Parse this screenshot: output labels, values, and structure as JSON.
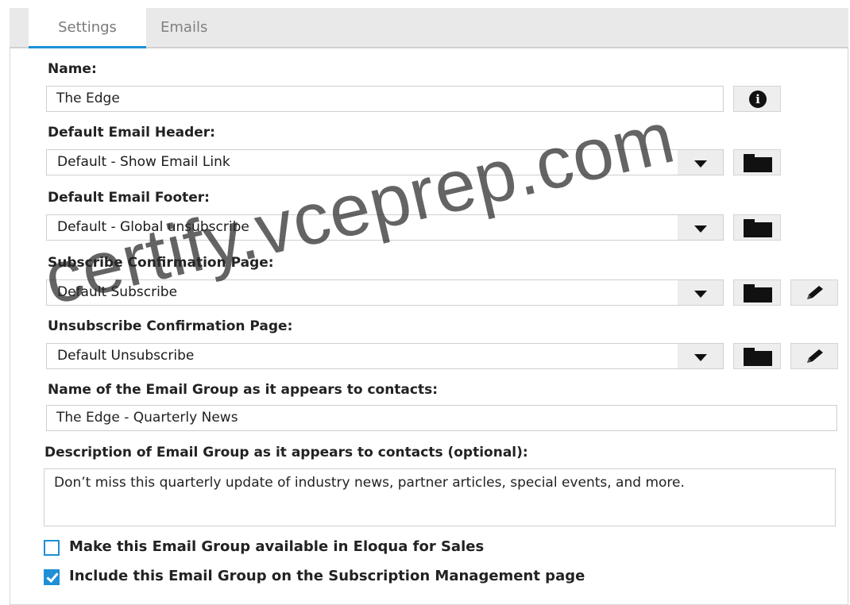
{
  "tabs": [
    {
      "label": "Settings",
      "active": true
    },
    {
      "label": "Emails",
      "active": false
    }
  ],
  "name": {
    "label": "Name:",
    "value": "The Edge",
    "info_icon": "info-icon"
  },
  "header": {
    "label": "Default Email Header:",
    "value": "Default - Show Email Link"
  },
  "footer": {
    "label": "Default Email Footer:",
    "value": "Default - Global unsubscribe"
  },
  "subscribe_page": {
    "label": "Subscribe Confirmation Page:",
    "value": "Default Subscribe"
  },
  "unsubscribe_page": {
    "label": "Unsubscribe Confirmation Page:",
    "value": "Default Unsubscribe"
  },
  "display_name": {
    "label": "Name of the Email Group as it appears to contacts:",
    "value": "The Edge - Quarterly News"
  },
  "description": {
    "label": "Description of Email Group as it appears to contacts (optional):",
    "value": "Don’t miss this quarterly update of industry news, partner articles, special events, and more."
  },
  "options": {
    "eloqua_for_sales": {
      "label": "Make this Email Group available in Eloqua for Sales",
      "checked": false
    },
    "subscription_mgmt": {
      "label": "Include this Email Group on the Subscription Management page",
      "checked": true
    }
  },
  "watermark": "certify.vceprep.com",
  "colors": {
    "accent": "#1f8fd6",
    "tabbar": "#e9e9e9",
    "button": "#eeeeee"
  }
}
